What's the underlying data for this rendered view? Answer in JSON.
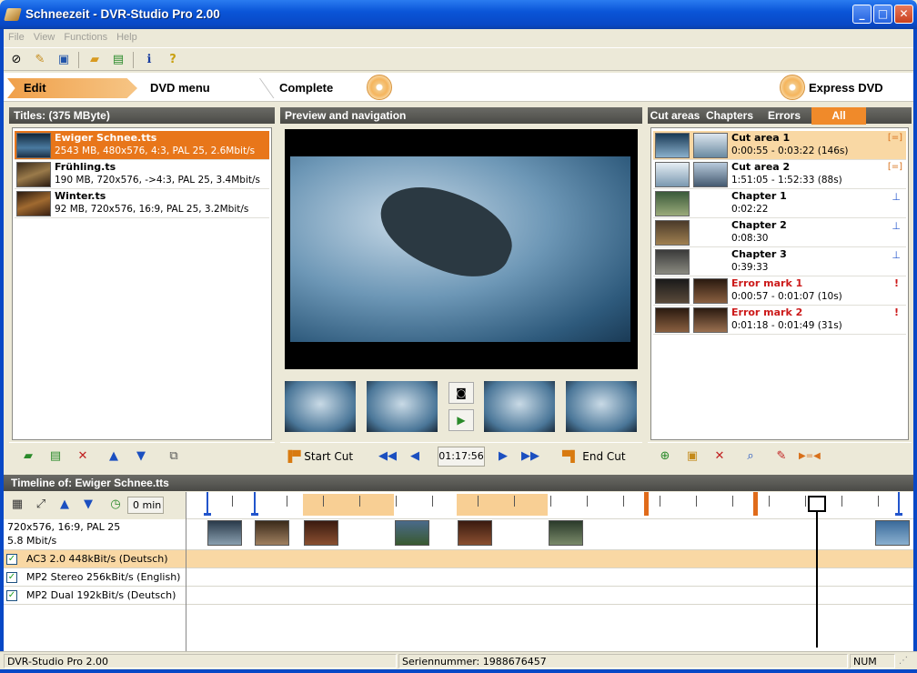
{
  "window": {
    "title": "Schneezeit - DVR-Studio Pro 2.00"
  },
  "menu": [
    "File",
    "View",
    "Functions",
    "Help"
  ],
  "steps": {
    "edit": "Edit",
    "dvd_menu": "DVD menu",
    "complete": "Complete",
    "express": "Express DVD"
  },
  "titles": {
    "header": "Titles: (375 MByte)",
    "items": [
      {
        "name": "Ewiger Schnee.tts",
        "info": "2543 MB, 480x576, 4:3, PAL 25, 2.6Mbit/s"
      },
      {
        "name": "Frühling.ts",
        "info": "190 MB, 720x576, ->4:3, PAL 25, 3.4Mbit/s"
      },
      {
        "name": "Winter.ts",
        "info": "92 MB, 720x576, 16:9, PAL 25, 3.2Mbit/s"
      }
    ]
  },
  "preview": {
    "header": "Preview and navigation",
    "start_cut": "Start Cut",
    "end_cut": "End Cut",
    "time": "01:17:56"
  },
  "markers": {
    "tabs": [
      "Cut areas",
      "Chapters",
      "Errors",
      "All"
    ],
    "items": [
      {
        "title": "Cut area 1",
        "detail": "0:00:55 - 0:03:22 (146s)",
        "kind": "cut"
      },
      {
        "title": "Cut area 2",
        "detail": "1:51:05 - 1:52:33 (88s)",
        "kind": "cut"
      },
      {
        "title": "Chapter 1",
        "detail": "0:02:22",
        "kind": "chapter"
      },
      {
        "title": "Chapter 2",
        "detail": "0:08:30",
        "kind": "chapter"
      },
      {
        "title": "Chapter 3",
        "detail": "0:39:33",
        "kind": "chapter"
      },
      {
        "title": "Error mark 1",
        "detail": "0:00:57 - 0:01:07 (10s)",
        "kind": "error"
      },
      {
        "title": "Error mark 2",
        "detail": "0:01:18 - 0:01:49 (31s)",
        "kind": "error"
      }
    ]
  },
  "timeline": {
    "header": "Timeline of: Ewiger Schnee.tts",
    "offset": "0 min",
    "video_line1": "720x576, 16:9, PAL 25",
    "video_line2": "5.8 Mbit/s",
    "audio": [
      "AC3 2.0 448kBit/s (Deutsch)",
      "MP2 Stereo 256kBit/s (English)",
      "MP2 Dual 192kBit/s (Deutsch)"
    ]
  },
  "status": {
    "app": "DVR-Studio Pro 2.00",
    "serial": "Seriennummer: 1988676457",
    "num": "NUM"
  },
  "colors": {
    "accent": "#e8761a",
    "titlebar": "#0a55d8"
  }
}
